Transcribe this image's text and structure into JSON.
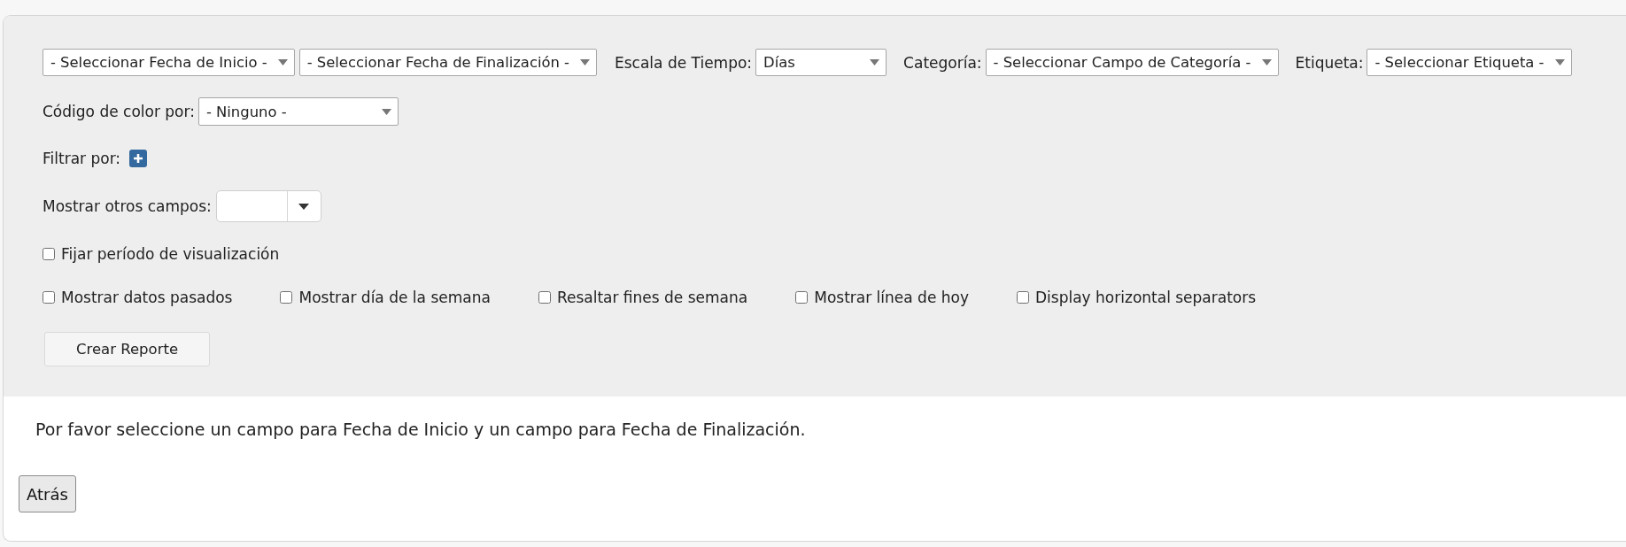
{
  "date_fields": [
    {
      "value": "- Seleccionar Fecha de Inicio -"
    },
    {
      "value": "- Seleccionar Fecha de Finalización -"
    }
  ],
  "time_scale": {
    "label": "Escala de Tiempo:",
    "value": "Días"
  },
  "category": {
    "label": "Categoría:",
    "value": "- Seleccionar Campo de Categoría -"
  },
  "tag": {
    "label": "Etiqueta:",
    "value": "- Seleccionar Etiqueta -"
  },
  "color_code": {
    "label": "Código de color por:",
    "value": "- Ninguno -"
  },
  "filter": {
    "label": "Filtrar por:"
  },
  "other_fields": {
    "label": "Mostrar otros campos:"
  },
  "fix_period": {
    "label": "Fijar período de visualización",
    "checked": false
  },
  "options": [
    {
      "label": "Mostrar datos pasados",
      "checked": false
    },
    {
      "label": "Mostrar día de la semana",
      "checked": false
    },
    {
      "label": "Resaltar fines de semana",
      "checked": false
    },
    {
      "label": "Mostrar línea de hoy",
      "checked": false
    },
    {
      "label": "Display horizontal separators",
      "checked": false
    }
  ],
  "create_button": "Crear Reporte",
  "message": "Por favor seleccione un campo para Fecha de Inicio y un campo para Fecha de Finalización.",
  "back_button": "Atrás"
}
